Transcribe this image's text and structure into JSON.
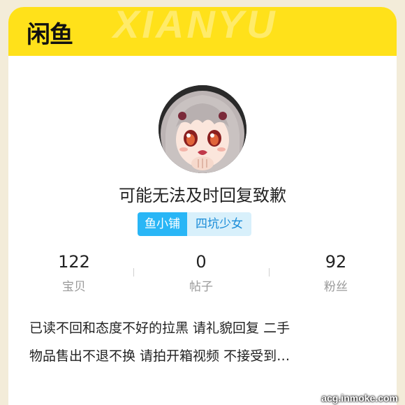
{
  "app": {
    "logo": "闲鱼",
    "watermark": "XIANYU",
    "accent_color": "#ffe11a"
  },
  "profile": {
    "avatar_icon": "avatar-anime-girl",
    "nickname": "可能无法及时回复致歉",
    "shop_tag": "鱼小铺",
    "title_tag": "四坑少女"
  },
  "stats": [
    {
      "value": "122",
      "label": "宝贝"
    },
    {
      "value": "0",
      "label": "帖子"
    },
    {
      "value": "92",
      "label": "粉丝"
    }
  ],
  "bio": {
    "line1": "已读不回和态度不好的拉黑 请礼貌回复 二手",
    "line2": "物品售出不退不换 请拍开箱视频 不接受到…"
  },
  "source_watermark": "acg.inmoke.com"
}
